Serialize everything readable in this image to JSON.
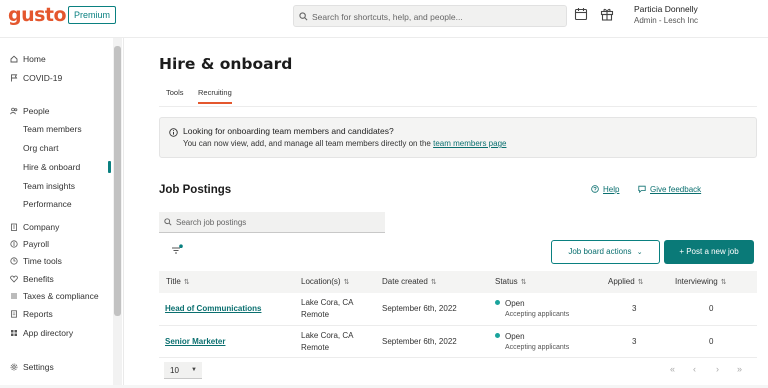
{
  "app": {
    "logo": "gusto",
    "plan_badge": "Premium"
  },
  "search": {
    "placeholder": "Search for shortcuts, help, and people..."
  },
  "user": {
    "name": "Particia Donnelly",
    "role": "Admin - Lesch Inc"
  },
  "icons": {
    "calendar": "calendar-icon",
    "gift": "gift-icon"
  },
  "sidebar": {
    "items": [
      {
        "label": "Home",
        "icon": "home-icon"
      },
      {
        "label": "COVID-19",
        "icon": "flag-icon"
      },
      {
        "label": "People",
        "icon": "people-icon"
      },
      {
        "label": "Company",
        "icon": "building-icon"
      },
      {
        "label": "Payroll",
        "icon": "payroll-icon"
      },
      {
        "label": "Time tools",
        "icon": "clock-icon"
      },
      {
        "label": "Benefits",
        "icon": "heart-icon"
      },
      {
        "label": "Taxes & compliance",
        "icon": "list-icon"
      },
      {
        "label": "Reports",
        "icon": "document-icon"
      },
      {
        "label": "App directory",
        "icon": "grid-icon"
      },
      {
        "label": "Settings",
        "icon": "gear-icon"
      }
    ],
    "people_sub": [
      "Team members",
      "Org chart",
      "Hire & onboard",
      "Team insights",
      "Performance"
    ],
    "active": "Hire & onboard"
  },
  "page": {
    "title": "Hire & onboard",
    "tabs": [
      "Tools",
      "Recruiting"
    ],
    "active_tab": "Recruiting"
  },
  "banner": {
    "title": "Looking for onboarding team members and candidates?",
    "text": "You can now view, add, and manage all team members directly on the",
    "link": "team members page"
  },
  "postings": {
    "title": "Job Postings",
    "help": "Help",
    "feedback": "Give feedback",
    "search_placeholder": "Search job postings",
    "board_actions": "Job board actions",
    "post_job": "+ Post a new job",
    "columns": [
      "Title",
      "Location(s)",
      "Date created",
      "Status",
      "Applied",
      "Interviewing"
    ],
    "rows": [
      {
        "title": "Head of Communications",
        "location": "Lake Cora, CA",
        "remote": "Remote",
        "date": "September 6th, 2022",
        "status": "Open",
        "status_sub": "Accepting applicants",
        "applied": "3",
        "interviewing": "0"
      },
      {
        "title": "Senior Marketer",
        "location": "Lake Cora, CA",
        "remote": "Remote",
        "date": "September 6th, 2022",
        "status": "Open",
        "status_sub": "Accepting applicants",
        "applied": "3",
        "interviewing": "0"
      }
    ],
    "page_size": "10"
  },
  "colors": {
    "brand": "#e4572e",
    "accent": "#0a8080",
    "status_open": "#1aa39c"
  }
}
